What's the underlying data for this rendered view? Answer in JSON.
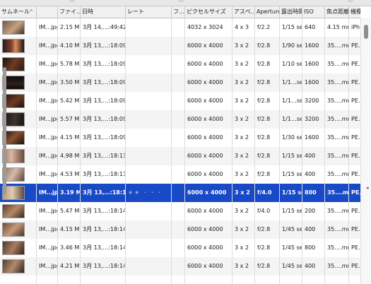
{
  "columns": [
    {
      "key": "thumb",
      "label": "サムネール",
      "sortable": true
    },
    {
      "key": "name",
      "label": ""
    },
    {
      "key": "size",
      "label": "ファイ…"
    },
    {
      "key": "date",
      "label": "日時"
    },
    {
      "key": "rating",
      "label": "レート"
    },
    {
      "key": "flag",
      "label": "フ…"
    },
    {
      "key": "pixels",
      "label": "ピクセルサイズ"
    },
    {
      "key": "aspect",
      "label": "アスペ…"
    },
    {
      "key": "aperture",
      "label": "Aperture"
    },
    {
      "key": "exposure",
      "label": "露出時間"
    },
    {
      "key": "iso",
      "label": "ISO"
    },
    {
      "key": "focal",
      "label": "焦点距離"
    },
    {
      "key": "model",
      "label": "機種"
    }
  ],
  "sort_indicator": "^",
  "rows": [
    {
      "name": "IM…jpg",
      "size": "2.15 MB",
      "date": "3月 14,…:49:42.00",
      "rating": "",
      "flag": "",
      "pixels": "4032 x 3024",
      "aspect": "4 x 3",
      "aperture": "f/2.2",
      "exposure": "1/15 sec",
      "iso": "640",
      "focal": "4.15 mm",
      "model": "iPh…"
    },
    {
      "name": "IM…jpg",
      "size": "4.10 MB",
      "date": "3月 13,…:18:09.00",
      "rating": "",
      "flag": "",
      "pixels": "6000 x 4000",
      "aspect": "3 x 2",
      "aperture": "f/2.8",
      "exposure": "1/90 sec",
      "iso": "1600",
      "focal": "35.…mm",
      "model": "PE…"
    },
    {
      "name": "IM…jpg",
      "size": "5.78 MB",
      "date": "3月 13,…:18:09.00",
      "rating": "",
      "flag": "",
      "pixels": "6000 x 4000",
      "aspect": "3 x 2",
      "aperture": "f/2.8",
      "exposure": "1/10 sec",
      "iso": "1600",
      "focal": "35.…mm",
      "model": "PE…"
    },
    {
      "name": "IM…jpg",
      "size": "3.50 MB",
      "date": "3月 13,…:18:09.00",
      "rating": "",
      "flag": "",
      "pixels": "6000 x 4000",
      "aspect": "3 x 2",
      "aperture": "f/2.8",
      "exposure": "1/1…sec",
      "iso": "1600",
      "focal": "35.…mm",
      "model": "PE…"
    },
    {
      "name": "IM…jpg",
      "size": "5.42 MB",
      "date": "3月 13,…:18:09.00",
      "rating": "",
      "flag": "",
      "pixels": "6000 x 4000",
      "aspect": "3 x 2",
      "aperture": "f/2.8",
      "exposure": "1/1…sec",
      "iso": "3200",
      "focal": "35.…mm",
      "model": "PE…"
    },
    {
      "name": "IM…jpg",
      "size": "5.57 MB",
      "date": "3月 13,…:18:09.00",
      "rating": "",
      "flag": "",
      "pixels": "6000 x 4000",
      "aspect": "3 x 2",
      "aperture": "f/2.8",
      "exposure": "1/1…sec",
      "iso": "3200",
      "focal": "35.…mm",
      "model": "PE…"
    },
    {
      "name": "IM…jpg",
      "size": "4.15 MB",
      "date": "3月 13,…:18:09.00",
      "rating": "",
      "flag": "",
      "pixels": "6000 x 4000",
      "aspect": "3 x 2",
      "aperture": "f/2.8",
      "exposure": "1/30 sec",
      "iso": "1600",
      "focal": "35.…mm",
      "model": "PE…"
    },
    {
      "name": "IM…jpg",
      "size": "4.98 MB",
      "date": "3月 13,…:18:13.00",
      "rating": "",
      "flag": "",
      "pixels": "6000 x 4000",
      "aspect": "3 x 2",
      "aperture": "f/2.8",
      "exposure": "1/15 sec",
      "iso": "400",
      "focal": "35.…mm",
      "model": "PE…"
    },
    {
      "name": "IM…jpg",
      "size": "4.53 MB",
      "date": "3月 13,…:18:13.00",
      "rating": "",
      "flag": "",
      "pixels": "6000 x 4000",
      "aspect": "3 x 2",
      "aperture": "f/2.8",
      "exposure": "1/15 sec",
      "iso": "400",
      "focal": "35.…mm",
      "model": "PE…"
    },
    {
      "name": "IM…jpg",
      "size": "3.19 MB",
      "date": "3月 13,…:18:13.00",
      "rating": "★★ · · ·",
      "flag": "",
      "pixels": "6000 x 4000",
      "aspect": "3 x 2",
      "aperture": "f/4.0",
      "exposure": "1/15 sec",
      "iso": "800",
      "focal": "35.…mm",
      "model": "PE…",
      "selected": true
    },
    {
      "name": "IM…jpg",
      "size": "5.47 MB",
      "date": "3月 13,…:18:14.00",
      "rating": "",
      "flag": "",
      "pixels": "6000 x 4000",
      "aspect": "3 x 2",
      "aperture": "f/4.0",
      "exposure": "1/15 sec",
      "iso": "200",
      "focal": "35.…mm",
      "model": "PE…"
    },
    {
      "name": "IM…jpg",
      "size": "4.15 MB",
      "date": "3月 13,…:18:14.00",
      "rating": "",
      "flag": "",
      "pixels": "6000 x 4000",
      "aspect": "3 x 2",
      "aperture": "f/2.8",
      "exposure": "1/45 sec",
      "iso": "400",
      "focal": "35.…mm",
      "model": "PE…"
    },
    {
      "name": "IM…jpg",
      "size": "3.46 MB",
      "date": "3月 13,…:18:14.00",
      "rating": "",
      "flag": "",
      "pixels": "6000 x 4000",
      "aspect": "3 x 2",
      "aperture": "f/2.8",
      "exposure": "1/45 sec",
      "iso": "800",
      "focal": "35.…mm",
      "model": "PE…"
    },
    {
      "name": "IM…jpg",
      "size": "4.21 MB",
      "date": "3月 13,…:18:14.00",
      "rating": "",
      "flag": "",
      "pixels": "6000 x 4000",
      "aspect": "3 x 2",
      "aperture": "f/2.8",
      "exposure": "1/45 sec",
      "iso": "400",
      "focal": "35.…mm",
      "model": "PE…"
    }
  ],
  "colors": {
    "selection": "#1849c7",
    "header_bg": "#f0f0f0",
    "row_alt": "#f4f4f4"
  },
  "icons": {
    "sort": "sort-ascending-icon",
    "thumbnail": "photo-thumbnail-icon",
    "star": "star-icon",
    "resize": "resize-handle-icon"
  }
}
